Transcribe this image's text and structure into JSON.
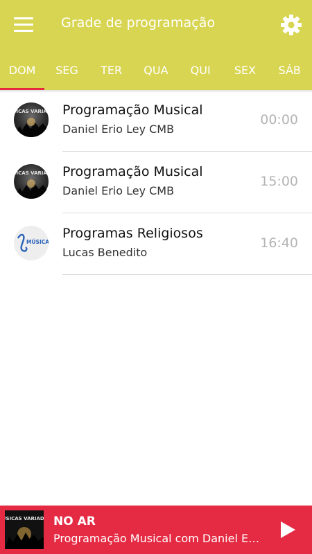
{
  "header": {
    "title": "Grade de programação",
    "menu_icon": "hamburger-menu-icon",
    "settings_icon": "gear-icon"
  },
  "tabs": [
    {
      "label": "DOM",
      "active": true
    },
    {
      "label": "SEG",
      "active": false
    },
    {
      "label": "TER",
      "active": false
    },
    {
      "label": "QUA",
      "active": false
    },
    {
      "label": "QUI",
      "active": false
    },
    {
      "label": "SEX",
      "active": false
    },
    {
      "label": "SÁB",
      "active": false
    }
  ],
  "schedule": [
    {
      "title": "Programação Musical",
      "host": "Daniel Erio Ley CMB",
      "time": "00:00",
      "avatar": "musicas-variadas-logo",
      "avatar_text": "MÚSICAS VARIADAS"
    },
    {
      "title": "Programação Musical",
      "host": "Daniel Erio Ley CMB",
      "time": "15:00",
      "avatar": "musicas-variadas-logo",
      "avatar_text": "MÚSICAS VARIADAS"
    },
    {
      "title": "Programas Religiosos",
      "host": "Lucas Benedito",
      "time": "16:40",
      "avatar": "musica-catolica-logo",
      "avatar_text": "MÚSICA CATÓLICA"
    }
  ],
  "player": {
    "status": "NO AR",
    "now_playing": "Programação Musical com Daniel E…",
    "cover": "musicas-variadas-logo",
    "cover_text": "MUSICAS VARIADAS",
    "play_icon": "play-icon"
  },
  "colors": {
    "primary": "#d8d552",
    "accent": "#e52b3d",
    "player_bg": "#e52b43",
    "time_text": "#b4b4b4"
  }
}
